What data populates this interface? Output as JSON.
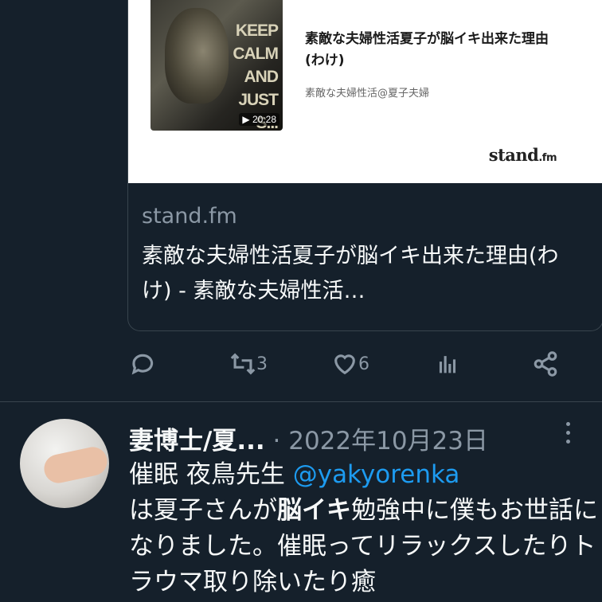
{
  "embed": {
    "thumbnail_text": [
      "KEEP",
      "CALM",
      "AND",
      "JUST",
      "S..."
    ],
    "duration": "▶ 20:28",
    "title": "素敵な夫婦性活夏子が脳イキ出来た理由(わけ)",
    "channel": "素敵な夫婦性活@夏子夫婦",
    "brand_main": "stand",
    "brand_suffix": ".fm"
  },
  "card": {
    "domain": "stand.fm",
    "text": "素敵な夫婦性活夏子が脳イキ出来た理由(わけ) - 素敵な夫婦性活…"
  },
  "actions": {
    "retweet_count": "3",
    "like_count": "6",
    "icons": [
      "reply-icon",
      "retweet-icon",
      "like-icon",
      "analytics-icon",
      "share-icon"
    ]
  },
  "tweet": {
    "author": "妻博士/夏...",
    "separator": " · ",
    "date": "2022年10月23日",
    "body_prefix": "催眠 夜鳥先生 ",
    "mention": "@yakyorenka",
    "body_mid1": "は夏子さんが",
    "body_bold": "脳イキ",
    "body_rest": "勉強中に僕もお世話になりました。催眠ってリラックスしたりトラウマ取り除いたり癒"
  },
  "colors": {
    "background": "#15202b",
    "text": "#f7f9f9",
    "muted": "#8b98a5",
    "link": "#1d9bf0",
    "border": "#38444d"
  }
}
